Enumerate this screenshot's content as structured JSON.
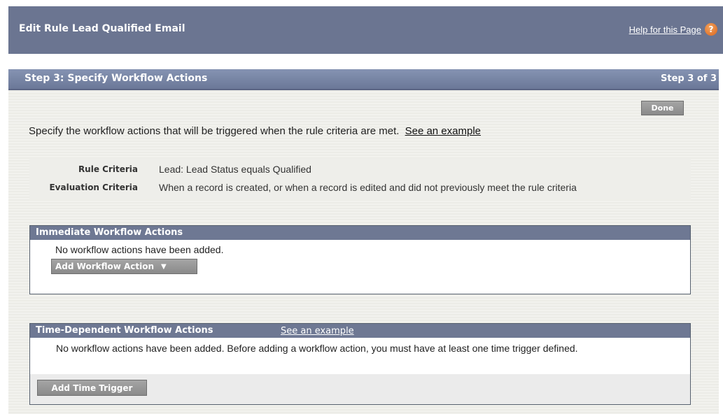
{
  "header": {
    "title": "Edit Rule Lead Qualified Email",
    "help_link": "Help for this Page",
    "help_icon": "?"
  },
  "step": {
    "title": "Step 3: Specify Workflow Actions",
    "count": "Step 3 of 3",
    "done_label": "Done"
  },
  "intro": {
    "text": "Specify the workflow actions that will be triggered when the rule criteria are met.",
    "link": "See an example"
  },
  "criteria": [
    {
      "label": "Rule Criteria",
      "value": "Lead: Lead Status equals Qualified"
    },
    {
      "label": "Evaluation Criteria",
      "value": "When a record is created, or when a record is edited and did not previously meet the rule criteria"
    }
  ],
  "immediate": {
    "title": "Immediate Workflow Actions",
    "message": "No workflow actions have been added.",
    "add_button": "Add Workflow Action",
    "chevron_icon": "chevron-down-icon"
  },
  "time_dependent": {
    "title": "Time-Dependent Workflow Actions",
    "link": "See an example",
    "message": "No workflow actions have been added. Before adding a workflow action, you must have at least one time trigger defined.",
    "add_button": "Add Time Trigger"
  },
  "colors": {
    "header_bg": "#6b7591",
    "step_bar": "#7583a3",
    "section_header": "#6e7893",
    "button_gray": "#999999",
    "help_icon": "#e07a2e"
  }
}
